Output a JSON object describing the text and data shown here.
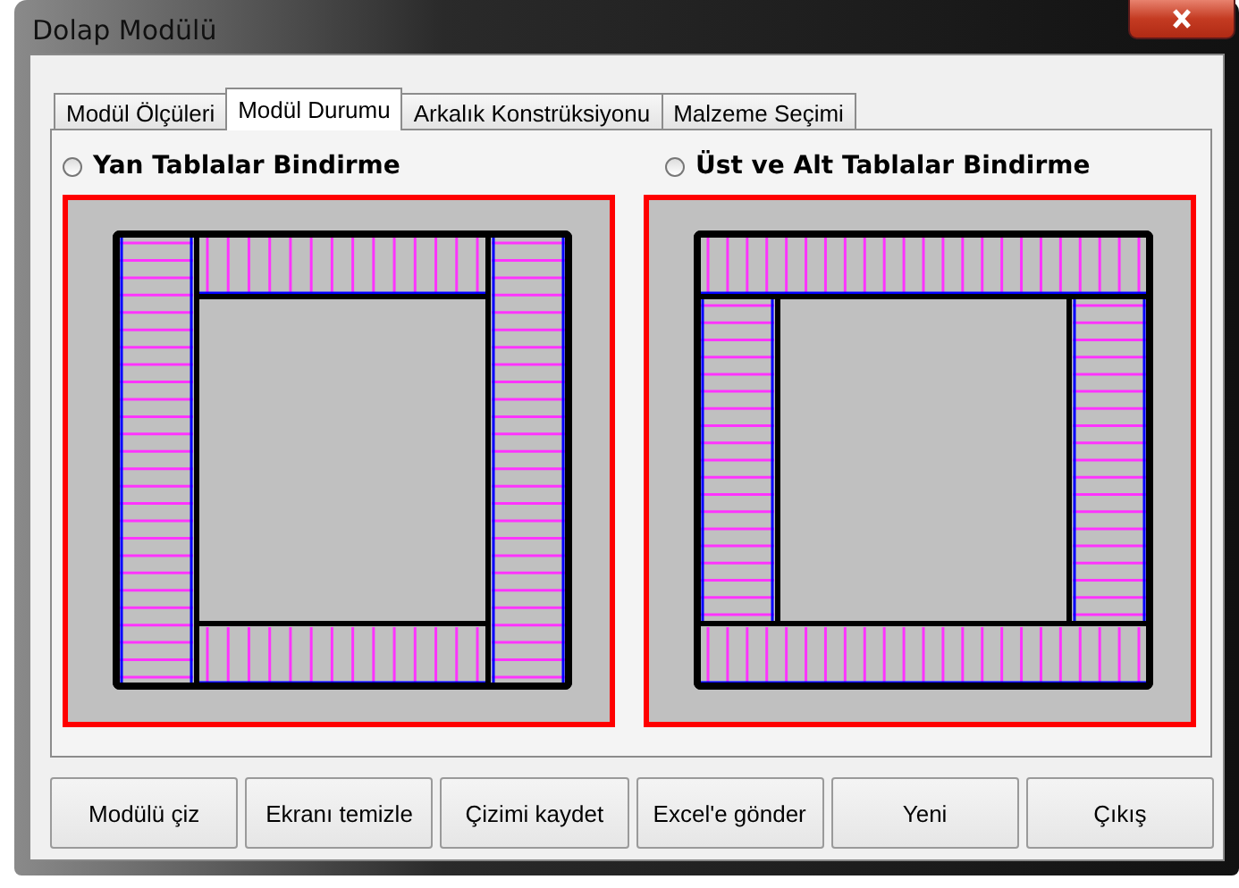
{
  "window": {
    "title": "Dolap Modülü"
  },
  "tabs": [
    {
      "label": "Modül Ölçüleri",
      "selected": false
    },
    {
      "label": "Modül Durumu",
      "selected": true
    },
    {
      "label": "Arkalık Konstrüksiyonu",
      "selected": false
    },
    {
      "label": "Malzeme Seçimi",
      "selected": false
    }
  ],
  "options": [
    {
      "label": "Yan Tablalar Bindirme",
      "selected": false,
      "kind": "sides"
    },
    {
      "label": "Üst ve Alt Tablalar Bindirme",
      "selected": false,
      "kind": "topbottom"
    }
  ],
  "buttons": [
    "Modülü çiz",
    "Ekranı temizle",
    "Çizimi kaydet",
    "Excel'e gönder",
    "Yeni",
    "Çıkış"
  ]
}
